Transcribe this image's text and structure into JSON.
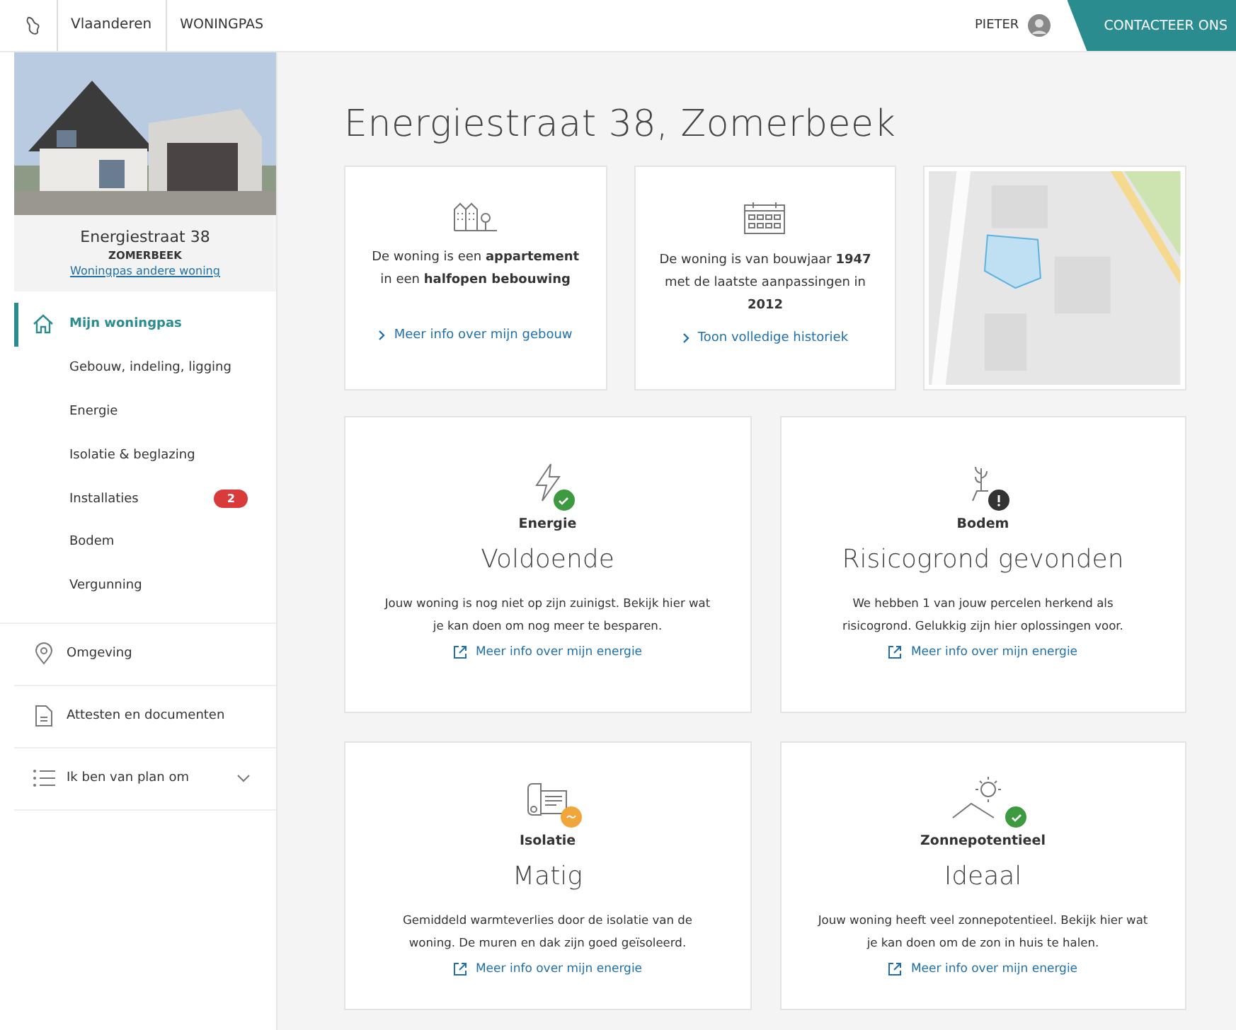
{
  "header": {
    "breadcrumb": [
      "Vlaanderen",
      "WONINGPAS"
    ],
    "user": "PIETER",
    "contact_button": "CONTACTEER ONS"
  },
  "sidebar": {
    "address": "Energiestraat 38",
    "city": "ZOMERBEEK",
    "other_link": "Woningpas andere woning",
    "nav": [
      {
        "label": "Mijn woningpas",
        "selected": true,
        "kind": "home"
      },
      {
        "label": "Gebouw, indeling, ligging",
        "selected": false,
        "kind": "plain"
      },
      {
        "label": "Energie",
        "selected": false,
        "kind": "plain"
      },
      {
        "label": "Isolatie & beglazing",
        "selected": false,
        "kind": "plain"
      },
      {
        "label": "Installaties",
        "selected": false,
        "kind": "plain",
        "badge": "2"
      },
      {
        "label": "Bodem",
        "selected": false,
        "kind": "plain"
      },
      {
        "label": "Vergunning",
        "selected": false,
        "kind": "plain"
      }
    ],
    "sections": [
      {
        "label": "Omgeving",
        "kind": "pin"
      },
      {
        "label": "Attesten en documenten",
        "kind": "document"
      },
      {
        "label": "Ik ben van plan om",
        "kind": "list",
        "expanded": false
      }
    ]
  },
  "main": {
    "title": "Energiestraat 38, Zomerbeek",
    "info_cards": [
      {
        "kind": "building",
        "text": "De woning is een **appartement** in een **halfopen bebouwing**",
        "link": "Meer info over mijn gebouw"
      },
      {
        "kind": "calendar",
        "text": "De woning is van bouwjaar **1947** met de laatste aanpassingen in **2012**",
        "link": "Toon volledige historiek"
      }
    ],
    "topic_cards": [
      {
        "kind": "lightning",
        "badge": {
          "kind": "check",
          "color": "#3d9a40"
        },
        "category": "Energie",
        "rating": "Voldoende",
        "description": "Jouw woning is nog niet op zijn zuinigst. Bekijk hier wat je kan doen om nog meer te besparen.",
        "link": "Meer info over mijn energie"
      },
      {
        "kind": "plant",
        "badge": {
          "kind": "exclamation",
          "color": "#333333"
        },
        "category": "Bodem",
        "rating": "Risicogrond gevonden",
        "description": "We hebben 1 van jouw percelen herkend als risicogrond. Gelukkig zijn hier oplossingen voor.",
        "link": "Meer info over mijn energie"
      },
      {
        "kind": "scroll",
        "badge": {
          "kind": "tilde",
          "color": "#f0a63a"
        },
        "category": "Isolatie",
        "rating": "Matig",
        "description": "Gemiddeld warmteverlies door de isolatie van de woning. De muren en dak zijn goed geïsoleerd.",
        "link": "Meer info over mijn energie"
      },
      {
        "kind": "sun",
        "badge": {
          "kind": "check",
          "color": "#3d9a40"
        },
        "category": "Zonnepotentieel",
        "rating": "Ideaal",
        "description": "Jouw woning heeft veel zonnepotentieel. Bekijk hier wat je kan doen om de zon in huis te halen.",
        "link": "Meer info over mijn energie"
      }
    ]
  }
}
